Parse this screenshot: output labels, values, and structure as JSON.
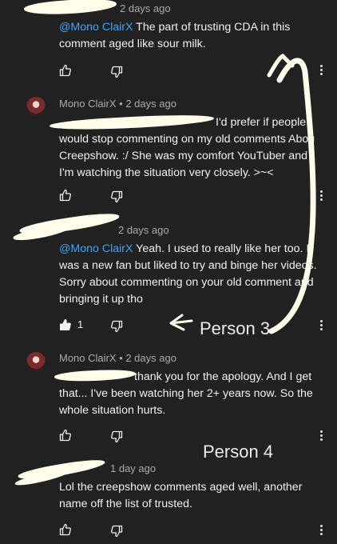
{
  "comments": [
    {
      "time": "2 days ago",
      "mention": "@Mono ClairX",
      "text_lines": [
        " The part of trusting CDA in this",
        "comment aged like sour milk."
      ],
      "likes": ""
    },
    {
      "author": "Mono ClairX",
      "separator": "•",
      "time": "2 days ago",
      "text_lines": [
        "I'd prefer if people",
        "would stop commenting on my old comments Abou",
        "Creepshow. :/ She was my comfort YouTuber and",
        "I'm watching the situation very closely. >~<"
      ],
      "likes": ""
    },
    {
      "time": "2 days ago",
      "mention": "@Mono ClairX",
      "text_lines": [
        " Yeah. I used to really like her too. I",
        "was a new fan but liked to try and binge her videos.",
        "Sorry about commenting on your old comment and",
        "bringing it up tho"
      ],
      "likes": "1"
    },
    {
      "author": "Mono ClairX",
      "separator": "•",
      "time": "2 days ago",
      "text_lines": [
        "thank you for the apology. And I get",
        "that... I've been watching her 2+ years now. So the",
        "whole situation hurts."
      ],
      "likes": ""
    },
    {
      "time": "1 day ago",
      "text_lines": [
        "Lol the creepshow comments aged well, another",
        "name off the list of trusted."
      ],
      "likes": ""
    }
  ],
  "annotations": {
    "person3": "Person 3",
    "person4": "Person 4"
  },
  "icons": {
    "like": "thumbs-up-icon",
    "dislike": "thumbs-down-icon",
    "more": "vertical-dots-icon"
  },
  "colors": {
    "background": "#212121",
    "mention": "#3ea6ff",
    "redaction": "#fffde9"
  }
}
